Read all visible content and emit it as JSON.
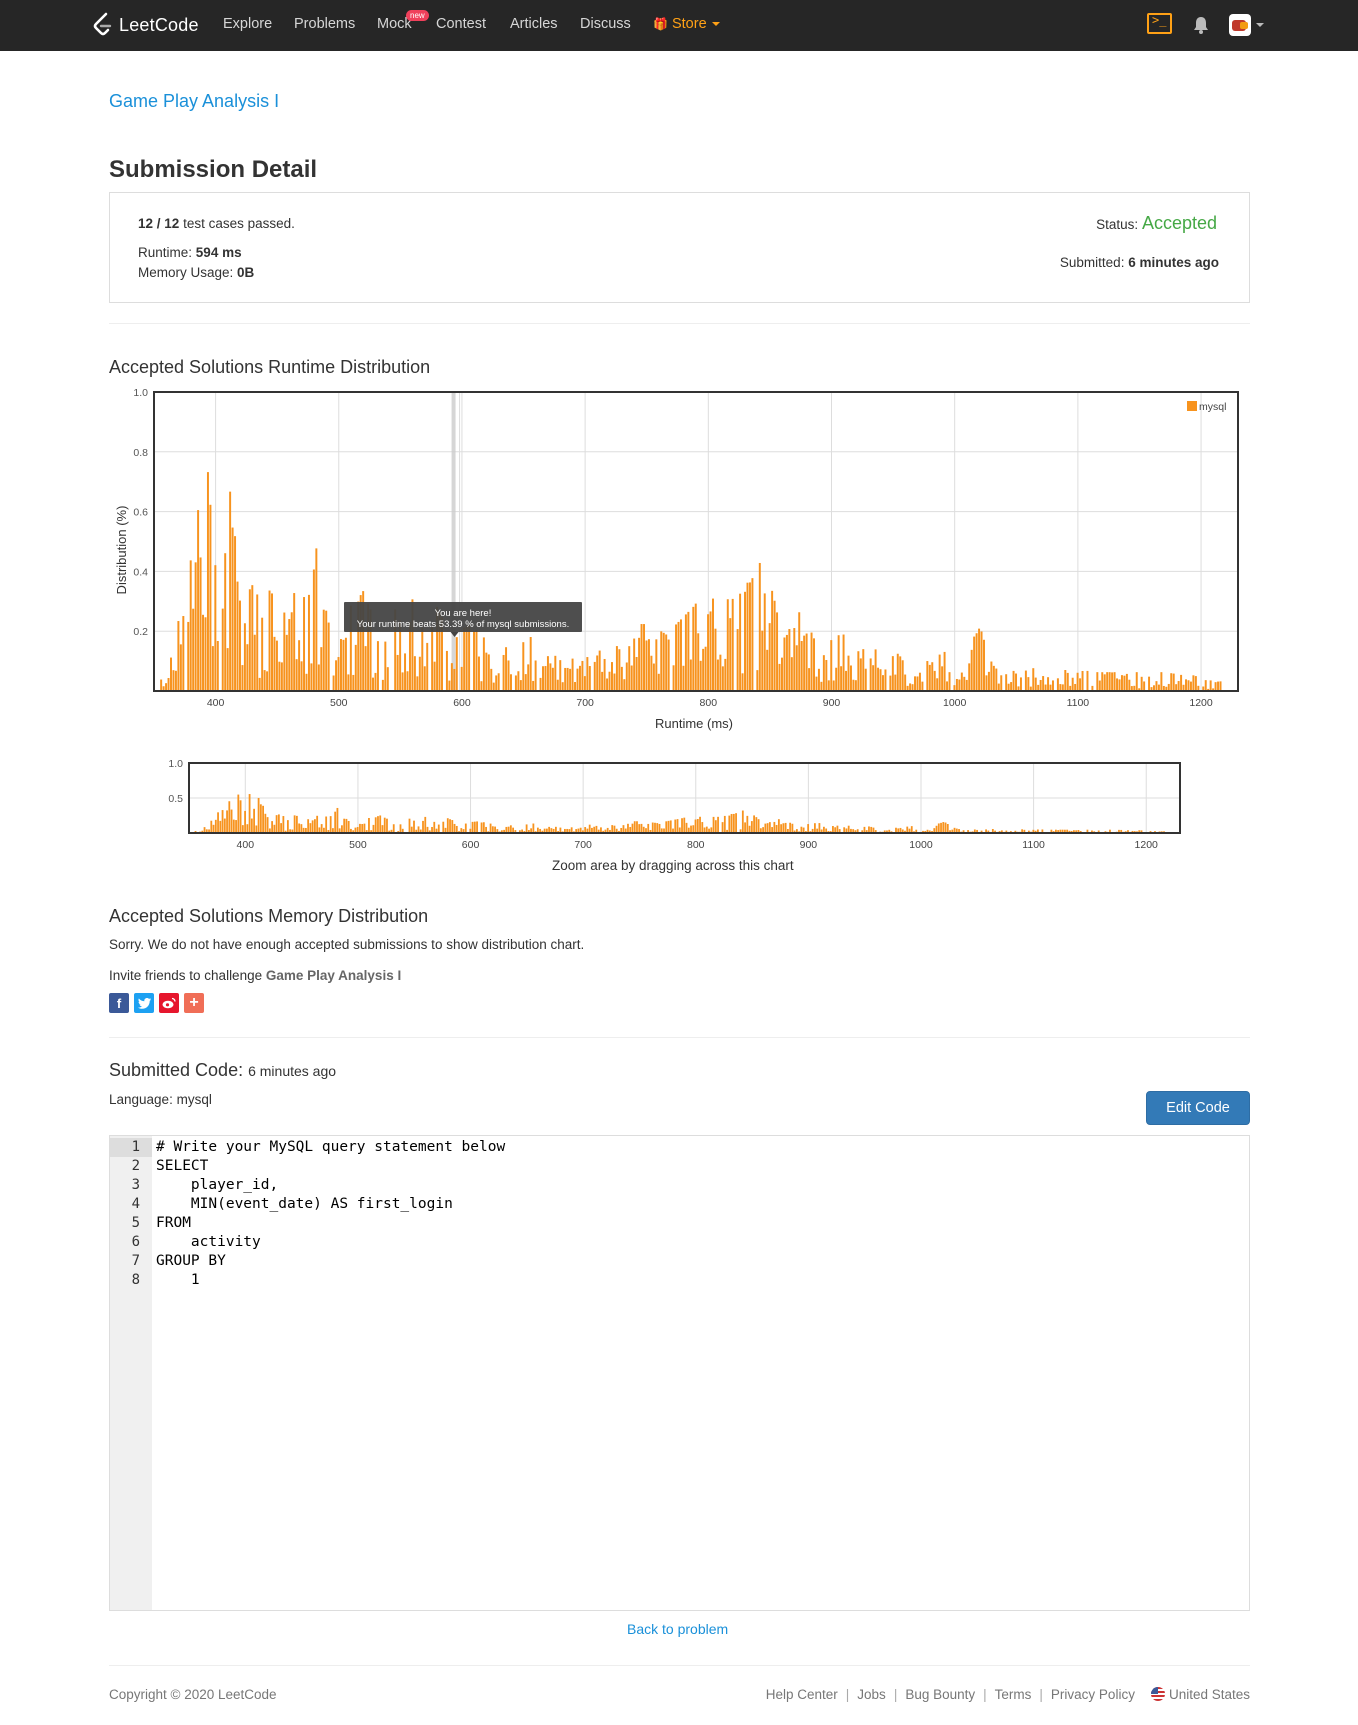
{
  "nav": {
    "brand": "LeetCode",
    "links": [
      "Explore",
      "Problems",
      "Mock",
      "Contest",
      "Articles",
      "Discuss"
    ],
    "mock_badge": "new",
    "store": "Store"
  },
  "problem_title": "Game Play Analysis I",
  "submission": {
    "heading": "Submission Detail",
    "cases_passed": "12 / 12",
    "cases_suffix": "test cases passed.",
    "runtime_label": "Runtime:",
    "runtime_value": "594 ms",
    "memory_label": "Memory Usage:",
    "memory_value": "0B",
    "status_label": "Status:",
    "status_value": "Accepted",
    "submitted_label": "Submitted:",
    "submitted_value": "6 minutes ago"
  },
  "runtime_section": {
    "title": "Accepted Solutions Runtime Distribution",
    "zoom_hint": "Zoom area by dragging across this chart"
  },
  "chart_data": [
    {
      "type": "bar",
      "xlabel": "Runtime (ms)",
      "ylabel": "Distribution (%)",
      "xlim": [
        350,
        1230
      ],
      "ylim": [
        0,
        1.0
      ],
      "xticks": [
        400,
        500,
        600,
        700,
        800,
        900,
        1000,
        1100,
        1200
      ],
      "yticks": [
        0.2,
        0.4,
        0.6,
        0.8,
        1.0
      ],
      "grid": true,
      "legend": "top-right",
      "series": [
        {
          "name": "mysql",
          "color": "#f7931e"
        }
      ],
      "marker": {
        "x": 594,
        "label": "You are here!",
        "text": "Your runtime beats 53.39 % of mysql submissions."
      },
      "samples": [
        [
          355,
          0.05
        ],
        [
          365,
          0.12
        ],
        [
          372,
          0.3
        ],
        [
          376,
          0.4
        ],
        [
          380,
          0.52
        ],
        [
          384,
          0.62
        ],
        [
          388,
          0.58
        ],
        [
          392,
          0.72
        ],
        [
          396,
          0.8
        ],
        [
          399,
          0.86
        ],
        [
          402,
          0.75
        ],
        [
          405,
          0.62
        ],
        [
          408,
          0.56
        ],
        [
          412,
          0.66
        ],
        [
          416,
          0.5
        ],
        [
          420,
          0.4
        ],
        [
          425,
          0.3
        ],
        [
          430,
          0.36
        ],
        [
          438,
          0.22
        ],
        [
          445,
          0.36
        ],
        [
          455,
          0.28
        ],
        [
          465,
          0.32
        ],
        [
          475,
          0.3
        ],
        [
          482,
          0.48
        ],
        [
          490,
          0.22
        ],
        [
          500,
          0.2
        ],
        [
          510,
          0.28
        ],
        [
          520,
          0.32
        ],
        [
          530,
          0.18
        ],
        [
          540,
          0.3
        ],
        [
          550,
          0.22
        ],
        [
          560,
          0.3
        ],
        [
          570,
          0.16
        ],
        [
          580,
          0.28
        ],
        [
          590,
          0.14
        ],
        [
          600,
          0.2
        ],
        [
          610,
          0.22
        ],
        [
          620,
          0.14
        ],
        [
          630,
          0.18
        ],
        [
          645,
          0.14
        ],
        [
          660,
          0.22
        ],
        [
          675,
          0.12
        ],
        [
          690,
          0.1
        ],
        [
          705,
          0.16
        ],
        [
          720,
          0.14
        ],
        [
          735,
          0.2
        ],
        [
          750,
          0.22
        ],
        [
          765,
          0.18
        ],
        [
          780,
          0.24
        ],
        [
          790,
          0.28
        ],
        [
          800,
          0.36
        ],
        [
          810,
          0.3
        ],
        [
          820,
          0.28
        ],
        [
          830,
          0.34
        ],
        [
          838,
          0.38
        ],
        [
          845,
          0.44
        ],
        [
          852,
          0.3
        ],
        [
          860,
          0.2
        ],
        [
          875,
          0.26
        ],
        [
          888,
          0.14
        ],
        [
          900,
          0.2
        ],
        [
          915,
          0.16
        ],
        [
          930,
          0.12
        ],
        [
          945,
          0.14
        ],
        [
          960,
          0.1
        ],
        [
          975,
          0.1
        ],
        [
          990,
          0.12
        ],
        [
          1005,
          0.12
        ],
        [
          1020,
          0.2
        ],
        [
          1035,
          0.08
        ],
        [
          1050,
          0.06
        ],
        [
          1065,
          0.08
        ],
        [
          1080,
          0.06
        ],
        [
          1095,
          0.08
        ],
        [
          1110,
          0.06
        ],
        [
          1125,
          0.06
        ],
        [
          1140,
          0.06
        ],
        [
          1155,
          0.06
        ],
        [
          1170,
          0.06
        ],
        [
          1185,
          0.05
        ],
        [
          1200,
          0.05
        ],
        [
          1215,
          0.04
        ]
      ]
    },
    {
      "type": "bar",
      "xlim": [
        350,
        1230
      ],
      "ylim": [
        0,
        1.0
      ],
      "xticks": [
        400,
        500,
        600,
        700,
        800,
        900,
        1000,
        1100,
        1200
      ],
      "yticks": [
        0.5,
        1.0
      ]
    }
  ],
  "memory_section": {
    "title": "Accepted Solutions Memory Distribution",
    "note": "Sorry. We do not have enough accepted submissions to show distribution chart.",
    "invite_prefix": "Invite friends to challenge",
    "invite_problem": "Game Play Analysis I"
  },
  "code_section": {
    "title": "Submitted Code:",
    "time": "6 minutes ago",
    "language_label": "Language:",
    "language": "mysql",
    "edit_button": "Edit Code",
    "lines": [
      "# Write your MySQL query statement below",
      "SELECT",
      "    player_id,",
      "    MIN(event_date) AS first_login",
      "FROM",
      "    activity",
      "GROUP BY",
      "    1"
    ]
  },
  "back_link": "Back to problem",
  "footer": {
    "copyright": "Copyright © 2020 LeetCode",
    "links": [
      "Help Center",
      "Jobs",
      "Bug Bounty",
      "Terms",
      "Privacy Policy"
    ],
    "region": "United States"
  }
}
